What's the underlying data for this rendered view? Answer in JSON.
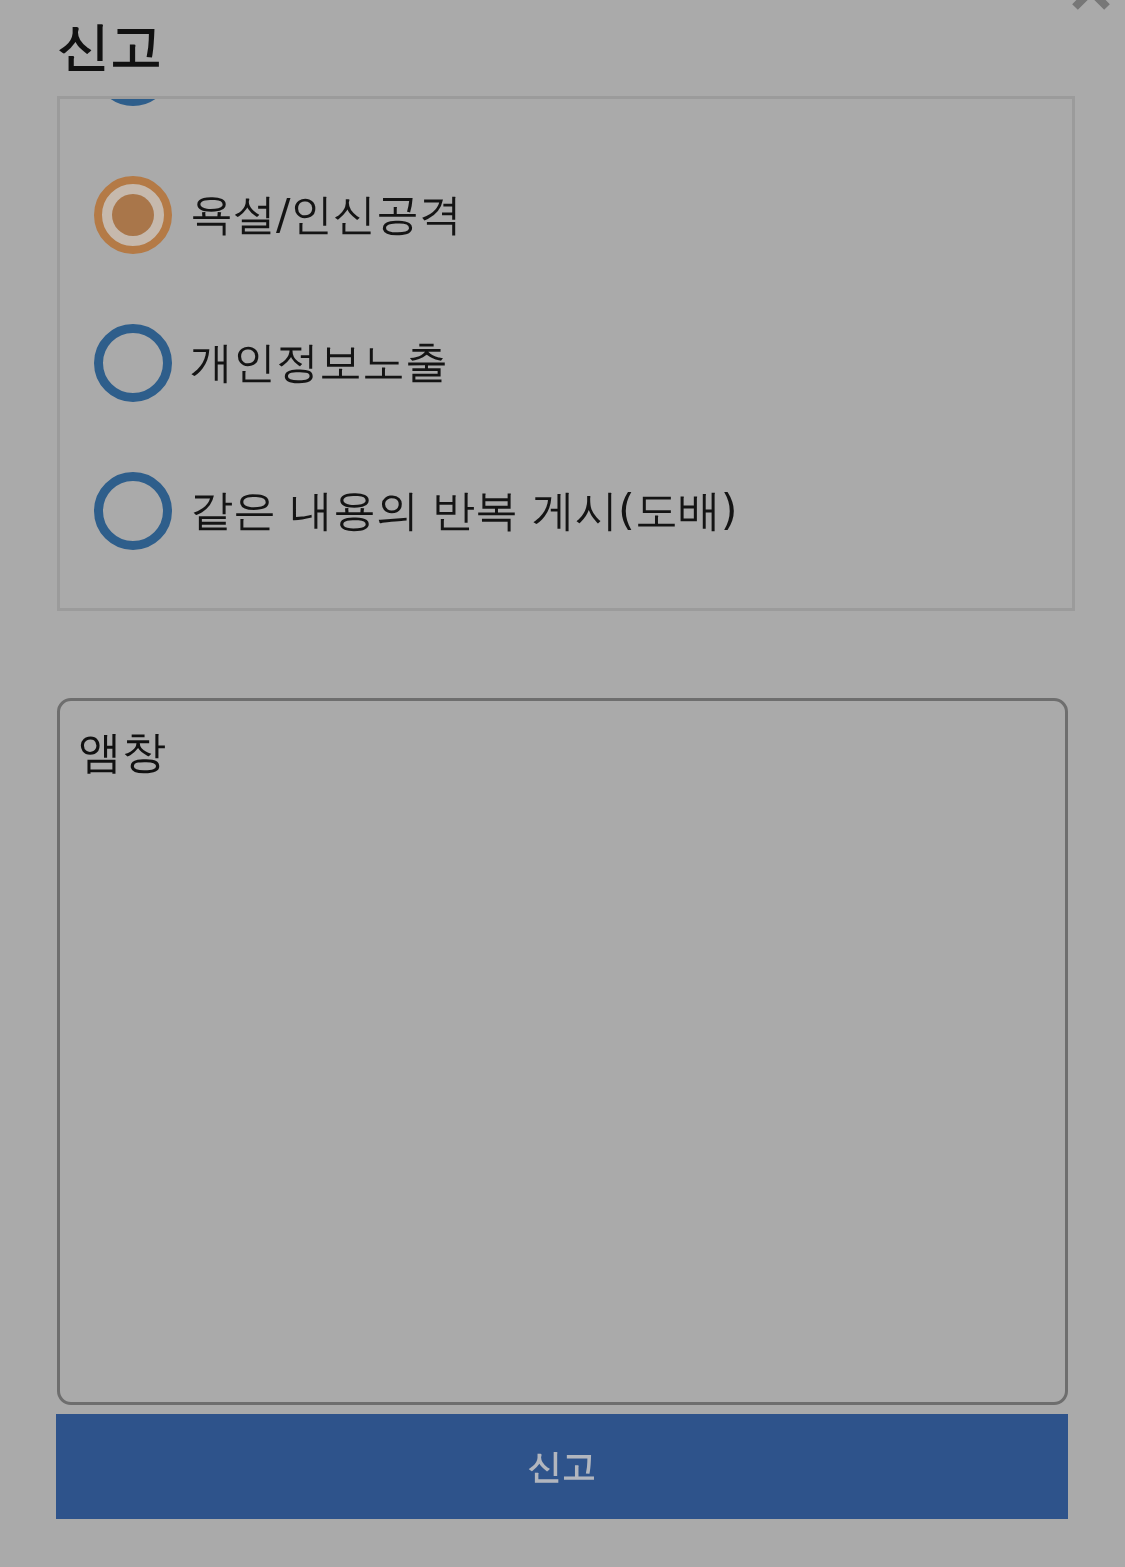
{
  "dialog": {
    "title": "신고"
  },
  "options": [
    {
      "selected": false
    },
    {
      "label": "욕설/인신공격",
      "selected": true
    },
    {
      "label": "개인정보노출",
      "selected": false
    },
    {
      "label": "같은 내용의 반복 게시(도배)",
      "selected": false
    }
  ],
  "details": {
    "value": "앰창"
  },
  "submit_button": {
    "label": "신고"
  }
}
